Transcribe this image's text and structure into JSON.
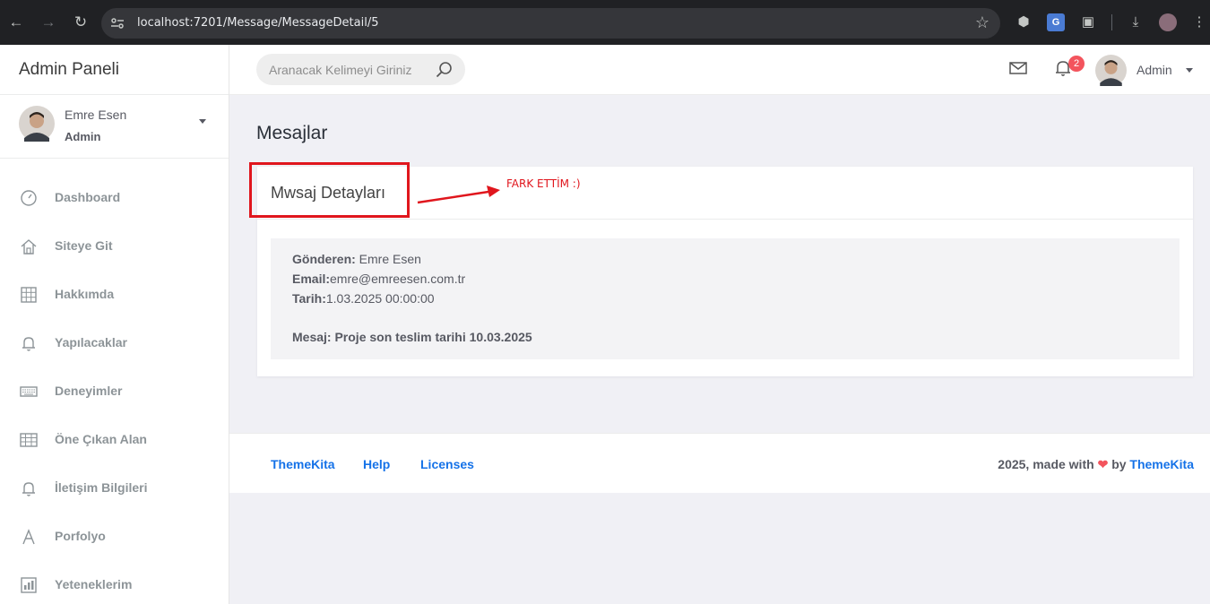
{
  "browser": {
    "url": "localhost:7201/Message/MessageDetail/5"
  },
  "sidebar": {
    "brand": "Admin Paneli",
    "user": {
      "name": "Emre Esen",
      "role": "Admin"
    },
    "items": [
      {
        "label": "Dashboard",
        "icon": "gauge-icon"
      },
      {
        "label": "Siteye Git",
        "icon": "home-icon"
      },
      {
        "label": "Hakkımda",
        "icon": "grid-icon"
      },
      {
        "label": "Yapılacaklar",
        "icon": "bell-icon"
      },
      {
        "label": "Deneyimler",
        "icon": "keyboard-icon"
      },
      {
        "label": "Öne Çıkan Alan",
        "icon": "table-icon"
      },
      {
        "label": "İletişim Bilgileri",
        "icon": "bell-icon"
      },
      {
        "label": "Porfolyo",
        "icon": "letter-a-icon"
      },
      {
        "label": "Yeteneklerim",
        "icon": "chart-icon"
      }
    ]
  },
  "topbar": {
    "search_placeholder": "Aranacak Kelimeyi Giriniz",
    "notification_count": "2",
    "user_name": "Admin"
  },
  "page": {
    "title": "Mesajlar",
    "card_title": "Mwsaj Detayları",
    "annotation": "FARK ETTİM :)",
    "message": {
      "sender_label": "Gönderen:",
      "sender": "Emre Esen",
      "email_label": "Email:",
      "email": "emre@emreesen.com.tr",
      "date_label": "Tarih:",
      "date": "1.03.2025 00:00:00",
      "body_label": "Mesaj:",
      "body": "Proje son teslim tarihi 10.03.2025"
    }
  },
  "footer": {
    "links": [
      "ThemeKita",
      "Help",
      "Licenses"
    ],
    "copyright_prefix": "2025, made with",
    "heart": "❤",
    "by": "by",
    "brand_link": "ThemeKita"
  },
  "colors": {
    "primary": "#1572e8",
    "danger": "#f3545d",
    "annotation": "#e0161d"
  }
}
